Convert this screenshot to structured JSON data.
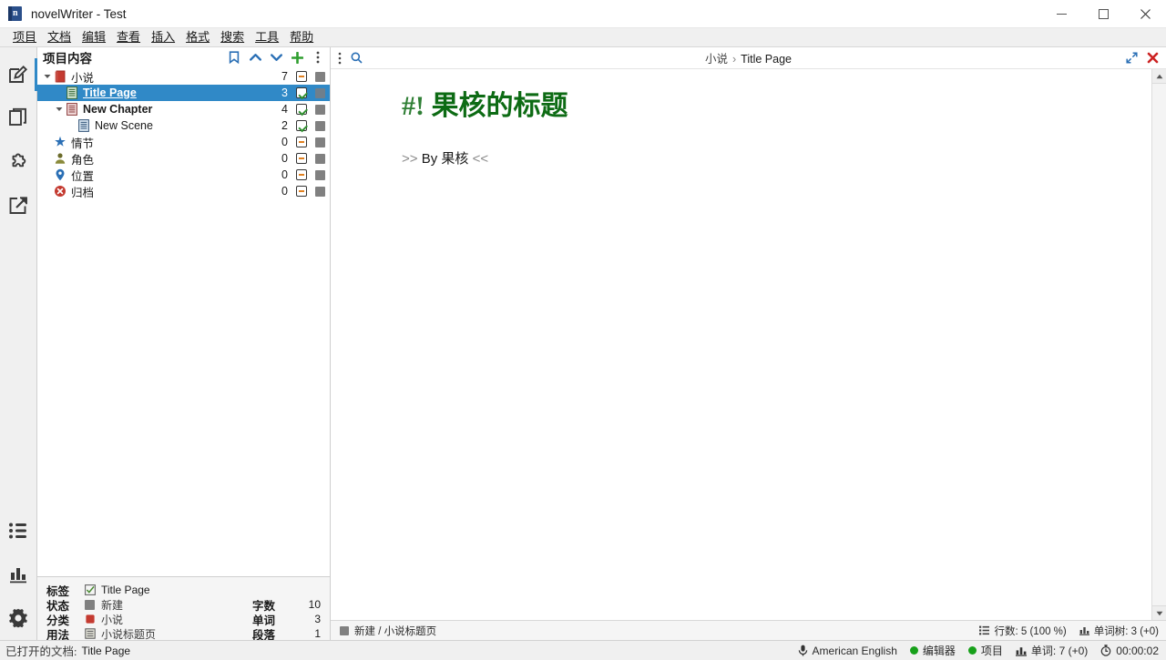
{
  "window": {
    "title": "novelWriter - Test",
    "app_icon": "novelwriter-logo-icon",
    "minimize_label": "minimize-icon",
    "maximize_label": "maximize-icon",
    "close_label": "close-icon"
  },
  "menubar": {
    "items": [
      {
        "label": "项目"
      },
      {
        "label": "文档"
      },
      {
        "label": "编辑"
      },
      {
        "label": "查看"
      },
      {
        "label": "插入"
      },
      {
        "label": "格式"
      },
      {
        "label": "搜索"
      },
      {
        "label": "工具"
      },
      {
        "label": "帮助"
      }
    ]
  },
  "rail": {
    "top_items": [
      {
        "icon": "edit-document-icon",
        "active": true
      },
      {
        "icon": "stack-documents-icon",
        "active": false
      },
      {
        "icon": "puzzle-piece-icon",
        "active": false
      },
      {
        "icon": "share-export-icon",
        "active": false
      }
    ],
    "bottom_items": [
      {
        "icon": "outline-list-icon"
      },
      {
        "icon": "bar-chart-stats-icon"
      },
      {
        "icon": "gear-settings-icon"
      }
    ]
  },
  "tree": {
    "header_title": "项目内容",
    "header_buttons": [
      {
        "icon": "bookmark-icon"
      },
      {
        "icon": "chevron-up-icon"
      },
      {
        "icon": "chevron-down-icon"
      },
      {
        "icon": "plus-add-icon"
      },
      {
        "icon": "more-vertical-icon"
      }
    ],
    "rows": [
      {
        "label": "小说",
        "icon": "root-novel-icon",
        "count": "7",
        "status": "dash",
        "flag": "gray-square",
        "indent": 0,
        "twisty": "down",
        "selected": false,
        "bold": false
      },
      {
        "label": "Title Page",
        "icon": "file-document-icon",
        "count": "3",
        "status": "check",
        "flag": "gray-square",
        "indent": 1,
        "twisty": "",
        "selected": true,
        "bold": true
      },
      {
        "label": "New Chapter",
        "icon": "file-document-icon",
        "count": "4",
        "status": "check",
        "flag": "gray-square",
        "indent": 1,
        "twisty": "down",
        "selected": false,
        "bold": true
      },
      {
        "label": "New Scene",
        "icon": "file-document-icon",
        "count": "2",
        "status": "check",
        "flag": "gray-square",
        "indent": 2,
        "twisty": "",
        "selected": false,
        "bold": false
      },
      {
        "label": "情节",
        "icon": "plot-star-icon",
        "count": "0",
        "status": "dash",
        "flag": "gray-square",
        "indent": 0,
        "twisty": "",
        "selected": false,
        "bold": false
      },
      {
        "label": "角色",
        "icon": "character-person-icon",
        "count": "0",
        "status": "dash",
        "flag": "gray-square",
        "indent": 0,
        "twisty": "",
        "selected": false,
        "bold": false
      },
      {
        "label": "位置",
        "icon": "location-pin-icon",
        "count": "0",
        "status": "dash",
        "flag": "gray-square",
        "indent": 0,
        "twisty": "",
        "selected": false,
        "bold": false
      },
      {
        "label": "归档",
        "icon": "archive-x-icon",
        "count": "0",
        "status": "dash",
        "flag": "gray-square",
        "indent": 0,
        "twisty": "",
        "selected": false,
        "bold": false
      }
    ]
  },
  "details": {
    "left_rows": [
      {
        "key": "标签",
        "icon": "check-tag-icon",
        "value": "Title Page"
      },
      {
        "key": "状态",
        "icon": "gray-square-icon",
        "value": "新建"
      },
      {
        "key": "分类",
        "icon": "red-novel-icon",
        "value": "小说"
      },
      {
        "key": "用法",
        "icon": "title-page-icon",
        "value": "小说标题页"
      }
    ],
    "right_rows": [
      {
        "key": "字数",
        "value": "10"
      },
      {
        "key": "单词",
        "value": "3"
      },
      {
        "key": "段落",
        "value": "1"
      }
    ]
  },
  "editor": {
    "header_left_icons": [
      {
        "icon": "more-vertical-icon"
      },
      {
        "icon": "search-magnifier-icon"
      }
    ],
    "breadcrumb": {
      "root": "小说",
      "separator": "›",
      "current": "Title Page"
    },
    "header_right_icons": [
      {
        "icon": "expand-fullscreen-icon"
      },
      {
        "icon": "close-x-icon"
      }
    ],
    "content": {
      "heading_marker": "#!",
      "heading_text": "果核的标题",
      "heading_color": "#0d6b14",
      "paragraph_open": ">>",
      "paragraph_text": "By 果核",
      "paragraph_close": "<<"
    },
    "footer": {
      "status_icon": "gray-square-icon",
      "status_text": "新建 / 小说标题页",
      "lines_icon": "lines-list-icon",
      "lines_text": "行数: 5 (100 %)",
      "words_icon": "bar-chart-icon",
      "words_text": "单词树: 3 (+0)"
    }
  },
  "statusbar": {
    "open_doc_label": "已打开的文档:",
    "open_doc_value": "Title Page",
    "language_icon": "microphone-language-icon",
    "language": "American English",
    "editor_status_label": "编辑器",
    "project_status_label": "项目",
    "words_icon": "bar-chart-icon",
    "words": "单词: 7 (+0)",
    "timer_icon": "stopwatch-icon",
    "timer": "00:00:02"
  },
  "colors": {
    "selection_blue": "#3089c7",
    "accent_blue": "#2a6fb5",
    "heading_green": "#0d6b14",
    "status_green": "#17a01a",
    "close_red": "#cc2222",
    "plus_green": "#2f9e2f",
    "root_red": "#c43a30"
  }
}
